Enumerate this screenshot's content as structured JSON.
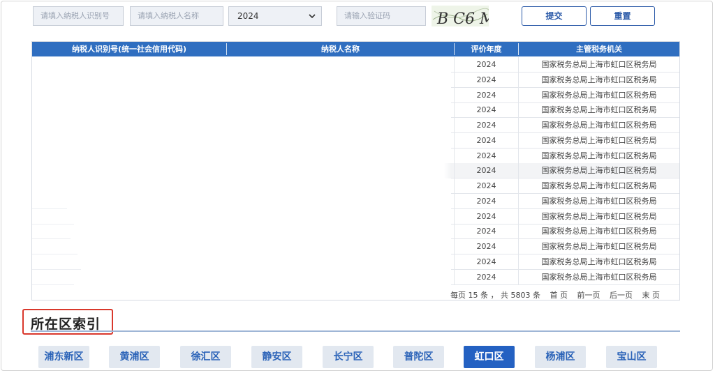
{
  "search": {
    "tax_id_placeholder": "请填入纳税人识别号",
    "name_placeholder": "请填入纳税人名称",
    "year_value": "2024",
    "captcha_placeholder": "请输入验证码",
    "captcha_text": "B C6 M",
    "submit_label": "提交",
    "reset_label": "重置"
  },
  "table": {
    "headers": [
      "纳税人识别号(统一社会信用代码)",
      "纳税人名称",
      "评价年度",
      "主管税务机关"
    ],
    "rows": [
      {
        "year": "2024",
        "authority": "国家税务总局上海市虹口区税务局"
      },
      {
        "year": "2024",
        "authority": "国家税务总局上海市虹口区税务局"
      },
      {
        "year": "2024",
        "authority": "国家税务总局上海市虹口区税务局"
      },
      {
        "year": "2024",
        "authority": "国家税务总局上海市虹口区税务局"
      },
      {
        "year": "2024",
        "authority": "国家税务总局上海市虹口区税务局"
      },
      {
        "year": "2024",
        "authority": "国家税务总局上海市虹口区税务局"
      },
      {
        "year": "2024",
        "authority": "国家税务总局上海市虹口区税务局"
      },
      {
        "year": "2024",
        "authority": "国家税务总局上海市虹口区税务局"
      },
      {
        "year": "2024",
        "authority": "国家税务总局上海市虹口区税务局"
      },
      {
        "year": "2024",
        "authority": "国家税务总局上海市虹口区税务局"
      },
      {
        "year": "2024",
        "authority": "国家税务总局上海市虹口区税务局"
      },
      {
        "year": "2024",
        "authority": "国家税务总局上海市虹口区税务局"
      },
      {
        "year": "2024",
        "authority": "国家税务总局上海市虹口区税务局"
      },
      {
        "year": "2024",
        "authority": "国家税务总局上海市虹口区税务局"
      },
      {
        "year": "2024",
        "authority": "国家税务总局上海市虹口区税务局"
      }
    ]
  },
  "pagination": {
    "info": "每页 15 条 ， 共 5803 条",
    "first": "首 页",
    "prev": "前一页",
    "next": "后一页",
    "last": "末 页"
  },
  "district_index": {
    "title": "所在区索引",
    "highlight_color": "#d9382c",
    "active_color": "#2461c2",
    "districts": [
      "浦东新区",
      "黄浦区",
      "徐汇区",
      "静安区",
      "长宁区",
      "普陀区",
      "虹口区",
      "杨浦区",
      "宝山区"
    ],
    "active": "虹口区"
  }
}
